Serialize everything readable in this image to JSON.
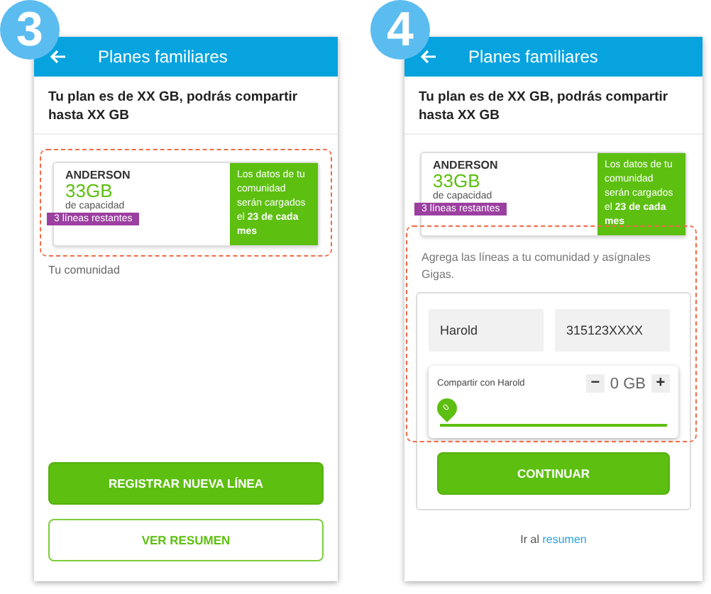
{
  "screens": [
    {
      "kind": "overview",
      "step": "3",
      "title": "Planes familiares",
      "plan_text": "Tu plan es de XX GB, podrás compartir hasta XX GB",
      "card": {
        "name": "ANDERSON",
        "capacity": "33GB",
        "capacity_label": "de capacidad",
        "ribbon": "3 líneas restantes",
        "note": "Los datos de tu comunidad serán cargados el **23 de cada mes**"
      },
      "community_label": "Tu comunidad",
      "buttons": [
        {
          "label": "REGISTRAR NUEVA LÍNEA",
          "kind": "primary"
        },
        {
          "label": "VER RESUMEN",
          "kind": "outline"
        }
      ]
    },
    {
      "kind": "add_line",
      "step": "4",
      "title": "Planes familiares",
      "plan_text": "Tu plan es de XX GB, podrás compartir hasta XX GB",
      "card": {
        "name": "ANDERSON",
        "capacity": "33GB",
        "capacity_label": "de capacidad",
        "ribbon": "3 líneas restantes",
        "note": "Los datos de tu comunidad serán cargados el **23 de cada mes**"
      },
      "instructions": "Agrega las líneas a tu comunidad y asígnales Gigas.",
      "fields": [
        {
          "value": "Harold"
        },
        {
          "value": "315123XXXX"
        }
      ],
      "share": {
        "label": "Compartir con Harold",
        "minus": "−",
        "amount": "0 GB",
        "plus": "+",
        "thumb_label": "0",
        "level": 0
      },
      "buttons": [
        {
          "label": "CONTINUAR",
          "kind": "primary"
        }
      ],
      "footer": {
        "text": "Ir al",
        "link": "resumen"
      }
    }
  ]
}
